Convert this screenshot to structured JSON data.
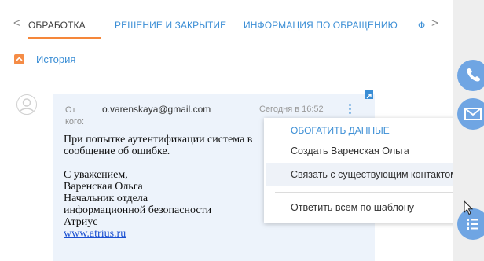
{
  "tabs": {
    "items": [
      {
        "label": "ОБРАБОТКА",
        "active": true
      },
      {
        "label": "РЕШЕНИЕ И ЗАКРЫТИЕ",
        "active": false
      },
      {
        "label": "ИНФОРМАЦИЯ ПО ОБРАЩЕНИЮ",
        "active": false
      },
      {
        "label": "Ф",
        "active": false
      }
    ],
    "prev_arrow": "<",
    "next_arrow": ">"
  },
  "history": {
    "label": "История"
  },
  "email": {
    "from_label": "От кого:",
    "from": "o.varenskaya@gmail.com",
    "time": "Сегодня в 16:52",
    "menu_dots": "⋮",
    "body_line1": "При попытке аутентификации система в",
    "body_line2": "сообщение об ошибке.",
    "signature": [
      "С уважением,",
      "Варенская Ольга",
      "Начальник отдела",
      "информационной безопасности",
      "Атриус"
    ],
    "link": "www.atrius.ru"
  },
  "dropdown": {
    "heading": "ОБОГАТИТЬ ДАННЫЕ",
    "items": [
      {
        "label": "Создать Варенская Ольга",
        "highlighted": false
      },
      {
        "label": "Связать с существующим контактом",
        "highlighted": true
      },
      {
        "label": "Ответить всем по шаблону",
        "highlighted": false
      }
    ]
  },
  "colors": {
    "accent": "#3b8ed5",
    "active_underline": "#f5873a",
    "history_toggle": "#f58c46",
    "card_bg": "#edf3fb",
    "right_panel_buttons": "#6fa5e3"
  },
  "right_panel": {
    "buttons": [
      "phone-icon",
      "email-icon",
      "list-icon"
    ]
  }
}
